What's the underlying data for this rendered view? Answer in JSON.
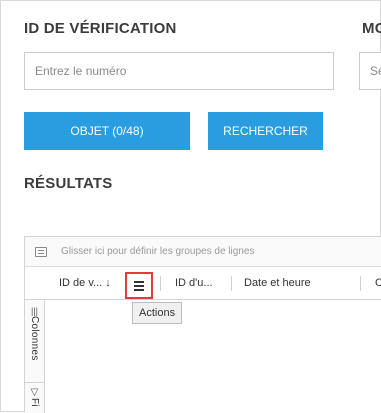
{
  "form": {
    "id_label": "ID DE VÉRIFICATION",
    "id_placeholder": "Entrez le numéro",
    "second_label": "MC",
    "second_placeholder": "Sé",
    "object_button": "OBJET (0/48)",
    "search_button": "RECHERCHER"
  },
  "results": {
    "title": "RÉSULTATS",
    "group_hint": "Glisser ici pour définir les groupes de lignes",
    "columns": [
      "ID de v... ↓",
      "ID d'u...",
      "Date et heure",
      "C"
    ],
    "sidebar_columns": "Colonnes",
    "sidebar_filters": "Fi",
    "actions_tooltip": "Actions"
  },
  "colors": {
    "accent": "#2a9ce0",
    "highlight": "#e23b3b"
  }
}
